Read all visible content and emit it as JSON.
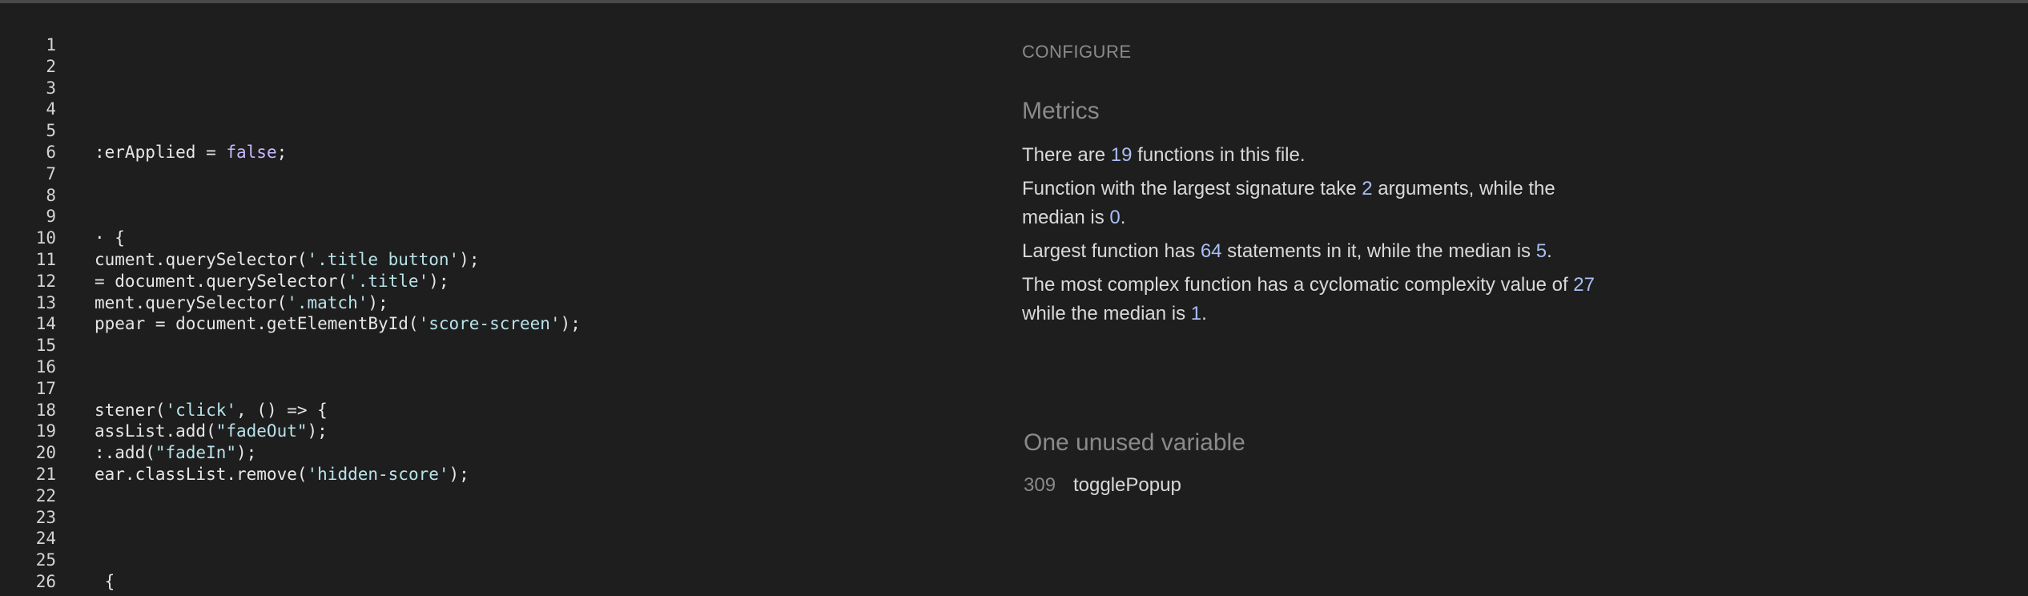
{
  "editor": {
    "lines": [
      {
        "n": "1",
        "parts": []
      },
      {
        "n": "2",
        "parts": []
      },
      {
        "n": "3",
        "parts": []
      },
      {
        "n": "4",
        "parts": []
      },
      {
        "n": "5",
        "parts": []
      },
      {
        "n": "6",
        "parts": [
          {
            "t": ":erApplied = ",
            "c": ""
          },
          {
            "t": "false",
            "c": "kw"
          },
          {
            "t": ";",
            "c": ""
          }
        ]
      },
      {
        "n": "7",
        "parts": []
      },
      {
        "n": "8",
        "parts": []
      },
      {
        "n": "9",
        "parts": []
      },
      {
        "n": "10",
        "parts": [
          {
            "t": "· {",
            "c": ""
          }
        ]
      },
      {
        "n": "11",
        "parts": [
          {
            "t": "cument.querySelector(",
            "c": ""
          },
          {
            "t": "'.title button'",
            "c": "str"
          },
          {
            "t": ");",
            "c": ""
          }
        ]
      },
      {
        "n": "12",
        "parts": [
          {
            "t": "= document.querySelector(",
            "c": ""
          },
          {
            "t": "'.title'",
            "c": "str"
          },
          {
            "t": ");",
            "c": ""
          }
        ]
      },
      {
        "n": "13",
        "parts": [
          {
            "t": "ment.querySelector(",
            "c": ""
          },
          {
            "t": "'.match'",
            "c": "str"
          },
          {
            "t": ");",
            "c": ""
          }
        ]
      },
      {
        "n": "14",
        "parts": [
          {
            "t": "ppear = document.getElementById(",
            "c": ""
          },
          {
            "t": "'score-screen'",
            "c": "str"
          },
          {
            "t": ");",
            "c": ""
          }
        ]
      },
      {
        "n": "15",
        "parts": []
      },
      {
        "n": "16",
        "parts": []
      },
      {
        "n": "17",
        "parts": []
      },
      {
        "n": "18",
        "parts": [
          {
            "t": "stener(",
            "c": ""
          },
          {
            "t": "'click'",
            "c": "str"
          },
          {
            "t": ", () => {",
            "c": ""
          }
        ]
      },
      {
        "n": "19",
        "parts": [
          {
            "t": "assList.add(",
            "c": ""
          },
          {
            "t": "\"fadeOut\"",
            "c": "str"
          },
          {
            "t": ");",
            "c": ""
          }
        ]
      },
      {
        "n": "20",
        "parts": [
          {
            "t": ":.add(",
            "c": ""
          },
          {
            "t": "\"fadeIn\"",
            "c": "str"
          },
          {
            "t": ");",
            "c": ""
          }
        ]
      },
      {
        "n": "21",
        "parts": [
          {
            "t": "ear.classList.remove(",
            "c": ""
          },
          {
            "t": "'hidden-score'",
            "c": "str"
          },
          {
            "t": ");",
            "c": ""
          }
        ]
      },
      {
        "n": "22",
        "parts": []
      },
      {
        "n": "23",
        "parts": []
      },
      {
        "n": "24",
        "parts": []
      },
      {
        "n": "25",
        "parts": []
      },
      {
        "n": "26",
        "parts": [
          {
            "t": " {",
            "c": ""
          }
        ]
      }
    ]
  },
  "panel": {
    "configure_label": "CONFIGURE",
    "metrics_title": "Metrics",
    "metrics": {
      "functions_pre": "There are ",
      "functions_count": "19",
      "functions_post": " functions in this file.",
      "signature_pre": "Function with the largest signature take ",
      "signature_max": "2",
      "signature_mid": " arguments, while the median is ",
      "signature_median": "0",
      "signature_post": ".",
      "largest_pre": "Largest function has ",
      "largest_max": "64",
      "largest_mid": " statements in it, while the median is ",
      "largest_median": "5",
      "largest_post": ".",
      "complex_pre": "The most complex function has a cyclomatic complexity value of ",
      "complex_max": "27",
      "complex_mid": " while the median is ",
      "complex_median": "1",
      "complex_post": "."
    },
    "unused_title": "One unused variable",
    "unused": {
      "line": "309",
      "name": "togglePopup"
    }
  },
  "colors": {
    "background": "#1e1e1e",
    "number_accent": "#a9bff5",
    "string_token": "#b8e2ea",
    "keyword_token": "#c9b8ff"
  }
}
